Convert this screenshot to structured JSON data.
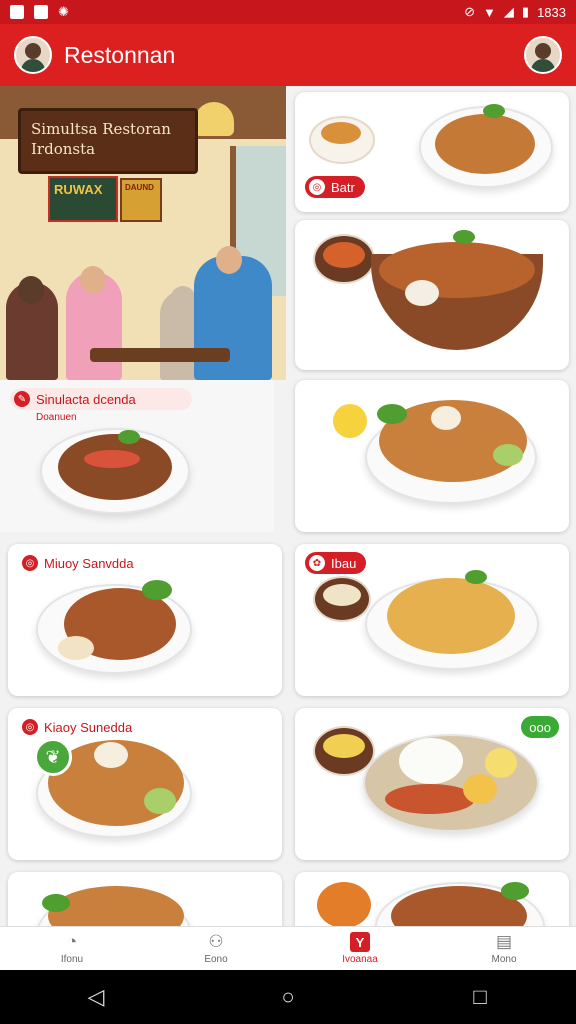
{
  "status_bar": {
    "time": "1833",
    "left_icons": [
      "notification-icon",
      "message-icon",
      "app-icon"
    ],
    "right_icons": [
      "alarm-icon",
      "wifi-icon",
      "signal-icon",
      "battery-icon"
    ]
  },
  "app_bar": {
    "title": "Restonnan"
  },
  "hero": {
    "sign_line1": "Simultsa Restoran",
    "sign_line2": "Irdonsta",
    "board_text": "RUWAX",
    "board2_text": "DAUND"
  },
  "cards": [
    {
      "tag": "Batr",
      "tag_style": "solid"
    },
    {
      "tag": ""
    },
    {
      "tag": "Sinulacta dcenda",
      "sub": "Doanuen",
      "tag_style": "light"
    },
    {
      "tag": ""
    },
    {
      "tag": "Miuoy Sanvdda",
      "tag_style": "light"
    },
    {
      "tag": "Ibau",
      "tag_style": "solid"
    },
    {
      "tag": "Kiaoy Sunedda",
      "tag_style": "light"
    },
    {
      "tag": "ooo",
      "tag_style": "green"
    }
  ],
  "bottom_nav": [
    {
      "label": "Ifonu",
      "icon": "home-icon"
    },
    {
      "label": "Eono",
      "icon": "profile-icon"
    },
    {
      "label": "Ivoanaa",
      "icon": "restaurant-icon",
      "active": true
    },
    {
      "label": "Mono",
      "icon": "menu-icon"
    }
  ],
  "colors": {
    "brand_red": "#dc1f1f",
    "tag_green": "#3aa935"
  }
}
